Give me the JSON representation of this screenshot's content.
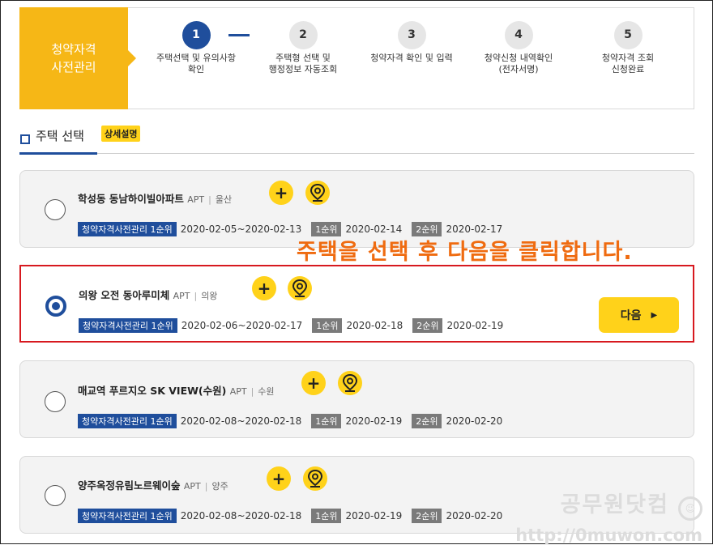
{
  "steps_header": {
    "title_line1": "청약자격",
    "title_line2": "사전관리",
    "steps": [
      {
        "num": "1",
        "line1": "주택선택 및 유의사항",
        "line2": "확인",
        "active": true
      },
      {
        "num": "2",
        "line1": "주택형 선택 및",
        "line2": "행정정보 자동조회",
        "active": false
      },
      {
        "num": "3",
        "line1": "청약자격 확인 및 입력",
        "line2": "",
        "active": false
      },
      {
        "num": "4",
        "line1": "청약신청 내역확인",
        "line2": "(전자서명)",
        "active": false
      },
      {
        "num": "5",
        "line1": "청약자격 조회",
        "line2": "신청완료",
        "active": false
      }
    ]
  },
  "section": {
    "title": "주택 선택",
    "detail_button": "상세설명"
  },
  "labels": {
    "type": "APT",
    "blue_badge": "청약자격사전관리 1순위",
    "rank1": "1순위",
    "rank2": "2순위",
    "next_button": "다음"
  },
  "houses": [
    {
      "name": "학성동 동남하이빌아파트",
      "region": "울산",
      "period": "2020-02-05~2020-02-13",
      "rank1_date": "2020-02-14",
      "rank2_date": "2020-02-17",
      "selected": false
    },
    {
      "name": "의왕 오전 동아루미체",
      "region": "의왕",
      "period": "2020-02-06~2020-02-17",
      "rank1_date": "2020-02-18",
      "rank2_date": "2020-02-19",
      "selected": true
    },
    {
      "name": "매교역 푸르지오 SK VIEW(수원)",
      "region": "수원",
      "period": "2020-02-08~2020-02-18",
      "rank1_date": "2020-02-19",
      "rank2_date": "2020-02-20",
      "selected": false
    },
    {
      "name": "양주옥정유림노르웨이숲",
      "region": "양주",
      "period": "2020-02-08~2020-02-18",
      "rank1_date": "2020-02-19",
      "rank2_date": "2020-02-20",
      "selected": false
    }
  ],
  "annotation": "주택을 선택 후 다음을 클릭합니다.",
  "watermark": {
    "title": "공무원닷컴",
    "url": "http://0muwon.com"
  },
  "colors": {
    "accent_yellow": "#ffd21a",
    "header_orange": "#f6b716",
    "primary_blue": "#1f4e9c",
    "highlight_red": "#d7191f",
    "annotation_orange": "#ef6b10"
  }
}
